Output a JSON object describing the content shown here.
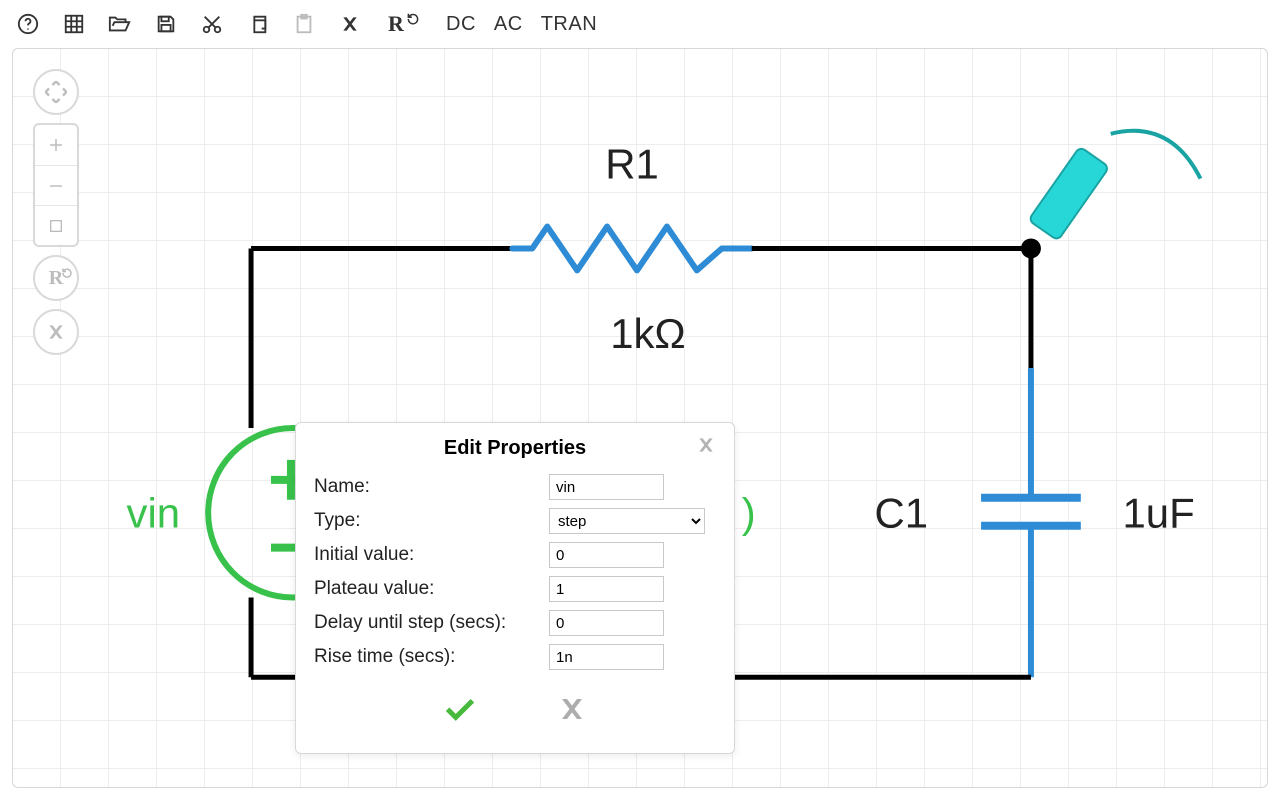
{
  "toolbar": {
    "sim": {
      "dc": "DC",
      "ac": "AC",
      "tran": "TRAN"
    }
  },
  "circuit": {
    "resistor": {
      "label": "R1",
      "value": "1kΩ"
    },
    "capacitor": {
      "label": "C1",
      "value": "1uF"
    },
    "source": {
      "label": "vin",
      "paren_right": ")"
    }
  },
  "dialog": {
    "title": "Edit Properties",
    "fields": {
      "name": {
        "label": "Name:",
        "value": "vin"
      },
      "type": {
        "label": "Type:",
        "value": "step"
      },
      "initial": {
        "label": "Initial value:",
        "value": "0"
      },
      "plateau": {
        "label": "Plateau value:",
        "value": "1"
      },
      "delay": {
        "label": "Delay until step (secs):",
        "value": "0"
      },
      "rise": {
        "label": "Rise time (secs):",
        "value": "1n"
      }
    }
  }
}
